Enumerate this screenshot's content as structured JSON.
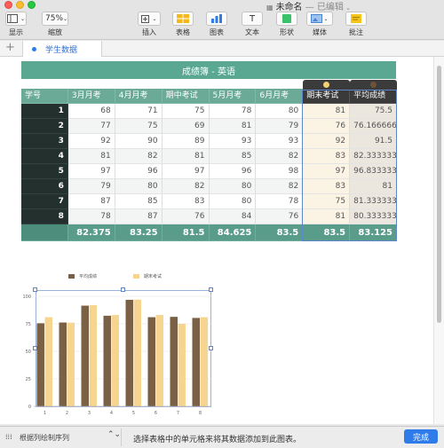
{
  "window": {
    "title": "未命名",
    "status": "已编辑"
  },
  "toolbar": {
    "view_label": "显示",
    "zoom_value": "75%",
    "zoom_label": "缩放",
    "insert_label": "插入",
    "table_label": "表格",
    "chart_label": "图表",
    "text_label": "文本",
    "shape_label": "形状",
    "media_label": "媒体",
    "comment_label": "批注"
  },
  "sheets": [
    {
      "label": "学生数据"
    }
  ],
  "table": {
    "title": "成绩簿 - 英语",
    "headers": [
      "学号",
      "3月月考",
      "4月月考",
      "期中考试",
      "5月月考",
      "6月月考",
      "期末考试",
      "平均成绩"
    ],
    "rows": [
      [
        "1",
        "68",
        "71",
        "75",
        "78",
        "80",
        "81",
        "75.5"
      ],
      [
        "2",
        "77",
        "75",
        "69",
        "81",
        "79",
        "76",
        "76.1666666"
      ],
      [
        "3",
        "92",
        "90",
        "89",
        "93",
        "93",
        "92",
        "91.5"
      ],
      [
        "4",
        "81",
        "82",
        "81",
        "85",
        "82",
        "83",
        "82.3333333"
      ],
      [
        "5",
        "97",
        "96",
        "97",
        "96",
        "98",
        "97",
        "96.8333333"
      ],
      [
        "6",
        "79",
        "80",
        "82",
        "80",
        "82",
        "83",
        "81"
      ],
      [
        "7",
        "87",
        "85",
        "83",
        "80",
        "78",
        "75",
        "81.3333333"
      ],
      [
        "8",
        "78",
        "87",
        "76",
        "84",
        "76",
        "81",
        "80.3333333"
      ]
    ],
    "footer": [
      "",
      "82.375",
      "83.25",
      "81.5",
      "84.625",
      "83.5",
      "83.5",
      "83.125"
    ]
  },
  "chart_data": {
    "type": "bar",
    "categories": [
      "1",
      "2",
      "3",
      "4",
      "5",
      "6",
      "7",
      "8"
    ],
    "series": [
      {
        "name": "平均成绩",
        "color": "#7a6146",
        "values": [
          75.5,
          76.17,
          91.5,
          82.33,
          96.83,
          81,
          81.33,
          80.33
        ]
      },
      {
        "name": "期末考试",
        "color": "#f6d590",
        "values": [
          81,
          76,
          92,
          83,
          97,
          83,
          75,
          81
        ]
      }
    ],
    "y_ticks": [
      "100",
      "75",
      "50",
      "25",
      "0"
    ],
    "ylim": [
      0,
      100
    ],
    "grid": true,
    "legend": "top"
  },
  "statusbar": {
    "series_mode": "根据列绘制序列",
    "message": "选择表格中的单元格来将其数据添加到此图表。",
    "done_label": "完成"
  }
}
